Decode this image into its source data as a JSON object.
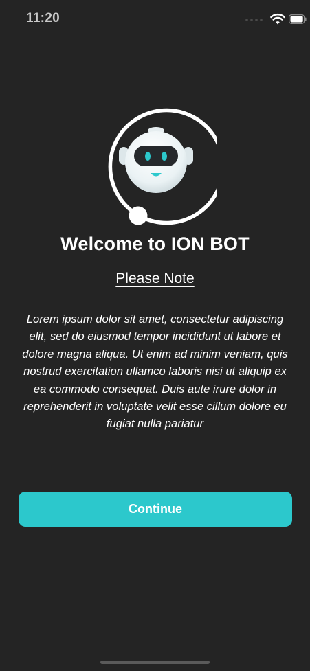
{
  "status_bar": {
    "time": "11:20",
    "icons": [
      "signal-dots-icon",
      "wifi-icon",
      "battery-icon"
    ]
  },
  "logo": {
    "icon": "robot-icon",
    "ring_color": "#ffffff",
    "eye_color": "#2cc8cc"
  },
  "title": "Welcome to ION BOT",
  "note": {
    "heading": "Please Note",
    "body": "Lorem ipsum dolor sit amet, consectetur adipiscing elit, sed do eiusmod tempor incididunt ut labore et dolore magna aliqua. Ut enim ad minim veniam, quis nostrud exercitation ullamco laboris nisi ut aliquip ex ea commodo consequat. Duis aute irure dolor in reprehenderit in voluptate velit esse cillum dolore eu fugiat nulla pariatur"
  },
  "continue_button": {
    "label": "Continue",
    "color": "#2cc8cc"
  },
  "theme": {
    "background": "#242424",
    "text": "#ffffff"
  }
}
